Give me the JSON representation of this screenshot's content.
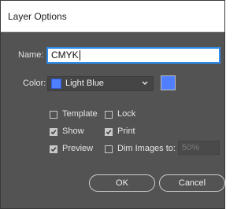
{
  "dialog": {
    "title": "Layer Options"
  },
  "name": {
    "label": "Name:",
    "value": "CMYK"
  },
  "color": {
    "label": "Color:",
    "selected": "Light Blue",
    "swatch_hex": "#4f7fff"
  },
  "options": {
    "template": {
      "label": "Template",
      "checked": false
    },
    "lock": {
      "label": "Lock",
      "checked": false
    },
    "show": {
      "label": "Show",
      "checked": true
    },
    "print": {
      "label": "Print",
      "checked": true
    },
    "preview": {
      "label": "Preview",
      "checked": true
    },
    "dim_images": {
      "label": "Dim Images to:",
      "checked": false,
      "value": "50%"
    }
  },
  "buttons": {
    "ok": "OK",
    "cancel": "Cancel"
  },
  "icons": {
    "dropdown": "chevron-down-icon",
    "check": "check-icon"
  },
  "colors": {
    "panel_bg": "#535353",
    "focus_ring": "#2d8ceb",
    "light_blue": "#4f7fff"
  }
}
